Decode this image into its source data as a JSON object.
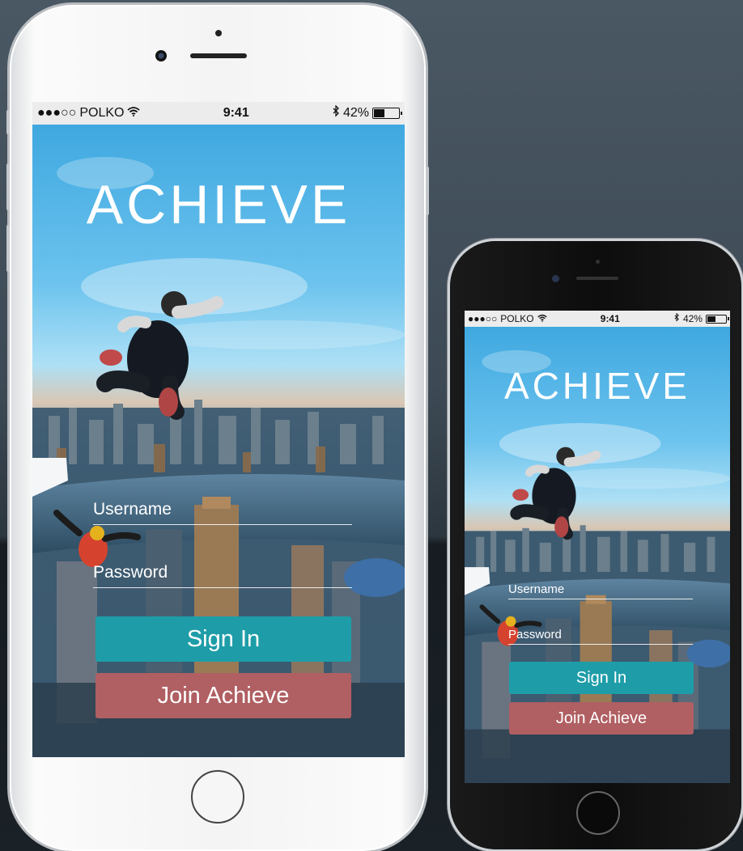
{
  "app": {
    "brand": "ACHIEVE"
  },
  "statusbar": {
    "carrier": "POLKO",
    "signal": "●●●○○",
    "wifi_icon": "wifi-icon",
    "time": "9:41",
    "bluetooth_icon": "bluetooth-icon",
    "battery_percent": "42%",
    "battery_level": 0.42
  },
  "login": {
    "username_placeholder": "Username",
    "password_placeholder": "Password",
    "signin_label": "Sign In",
    "join_label": "Join Achieve"
  },
  "colors": {
    "signin_button": "#1e9da8",
    "join_button": "#b05f62",
    "white_phone_body": "#f4f4f4",
    "black_phone_body": "#0d0d0d"
  }
}
